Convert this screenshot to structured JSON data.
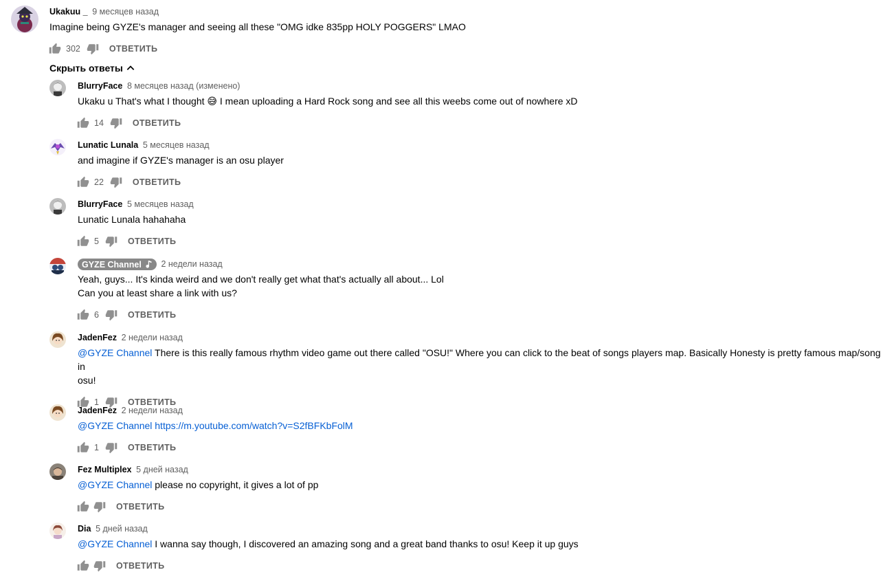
{
  "labels": {
    "reply": "ОТВЕТИТЬ",
    "hide_replies": "Скрыть ответы"
  },
  "colors": {
    "mention": "#065fd4",
    "owner_chip_bg": "#888888",
    "secondary_text": "#606060"
  },
  "top_comment": {
    "author": "Ukakuu _",
    "time": "9 месяцев назад",
    "text": "Imagine being GYZE's manager and seeing all these \"OMG idke 835pp HOLY POGGERS\" LMAO",
    "likes": "302"
  },
  "replies": [
    {
      "author": "BlurryFace",
      "time": "8 месяцев назад (изменено)",
      "text_line1": "Ukaku u That's what I thought 😅 I mean uploading a Hard Rock song and see all this weebs come out of nowhere xD",
      "likes": "14"
    },
    {
      "author": "Lunatic Lunala",
      "time": "5 месяцев назад",
      "text_line1": "and imagine if GYZE's manager is an osu player",
      "likes": "22"
    },
    {
      "author": "BlurryFace",
      "time": "5 месяцев назад",
      "text_line1": "Lunatic Lunala hahahaha",
      "likes": "5"
    },
    {
      "author": "GYZE Channel",
      "time": "2 недели назад",
      "text_line1": "Yeah, guys... It's kinda weird and we don't really get what that's actually all about... Lol",
      "text_line2": "Can you at least share a link with us?",
      "likes": "6"
    },
    {
      "author": "JadenFez",
      "time": "2 недели назад",
      "mention": "@GYZE Channel",
      "text_line1": "There is this really famous rhythm video game out there called \"OSU!\" Where you can click to the beat of songs players map. Basically Honesty is pretty famous map/song in",
      "text_line2": "osu!",
      "likes": "1"
    },
    {
      "author": "JadenFez",
      "time": "2 недели назад",
      "mention": "@GYZE Channel",
      "link": "https://m.youtube.com/watch?v=S2fBFKbFolM",
      "likes": "1"
    },
    {
      "author": "Fez Multiplex",
      "time": "5 дней назад",
      "mention": "@GYZE Channel",
      "text_line1": "please no copyright, it gives a lot of pp",
      "likes": ""
    },
    {
      "author": "Dia",
      "time": "5 дней назад",
      "mention": "@GYZE Channel",
      "text_line1": "I wanna say though, I discovered an amazing song and a great band thanks to osu! Keep it up guys",
      "likes": ""
    }
  ]
}
